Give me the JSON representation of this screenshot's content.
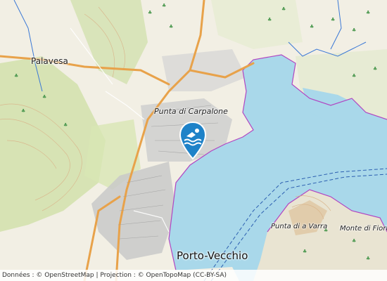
{
  "map": {
    "place_labels": {
      "palavesa": "Palavesa",
      "punta_carpalone": "Punta di Carpalone",
      "punta_varra": "Punta di a Varra",
      "monte_fiori": "Monte di Fiori",
      "porto_vecchio": "Porto-Vecchio"
    },
    "marker": {
      "icon": "swimmer-pin-icon",
      "color": "#1e82c8"
    },
    "colors": {
      "water": "#a9d8ea",
      "land": "#f2efe4",
      "forest": "#cfe0a8",
      "urban": "#c7c7c7",
      "road_major": "#e8a24a",
      "contour": "#d9b48a",
      "shore": "#b146c2"
    }
  },
  "attribution": {
    "prefix": "Données : ©",
    "osm": "OpenStreetMap",
    "separator": "| Projection : ©",
    "otm": "OpenTopoMap",
    "license": "(CC-BY-SA)"
  }
}
